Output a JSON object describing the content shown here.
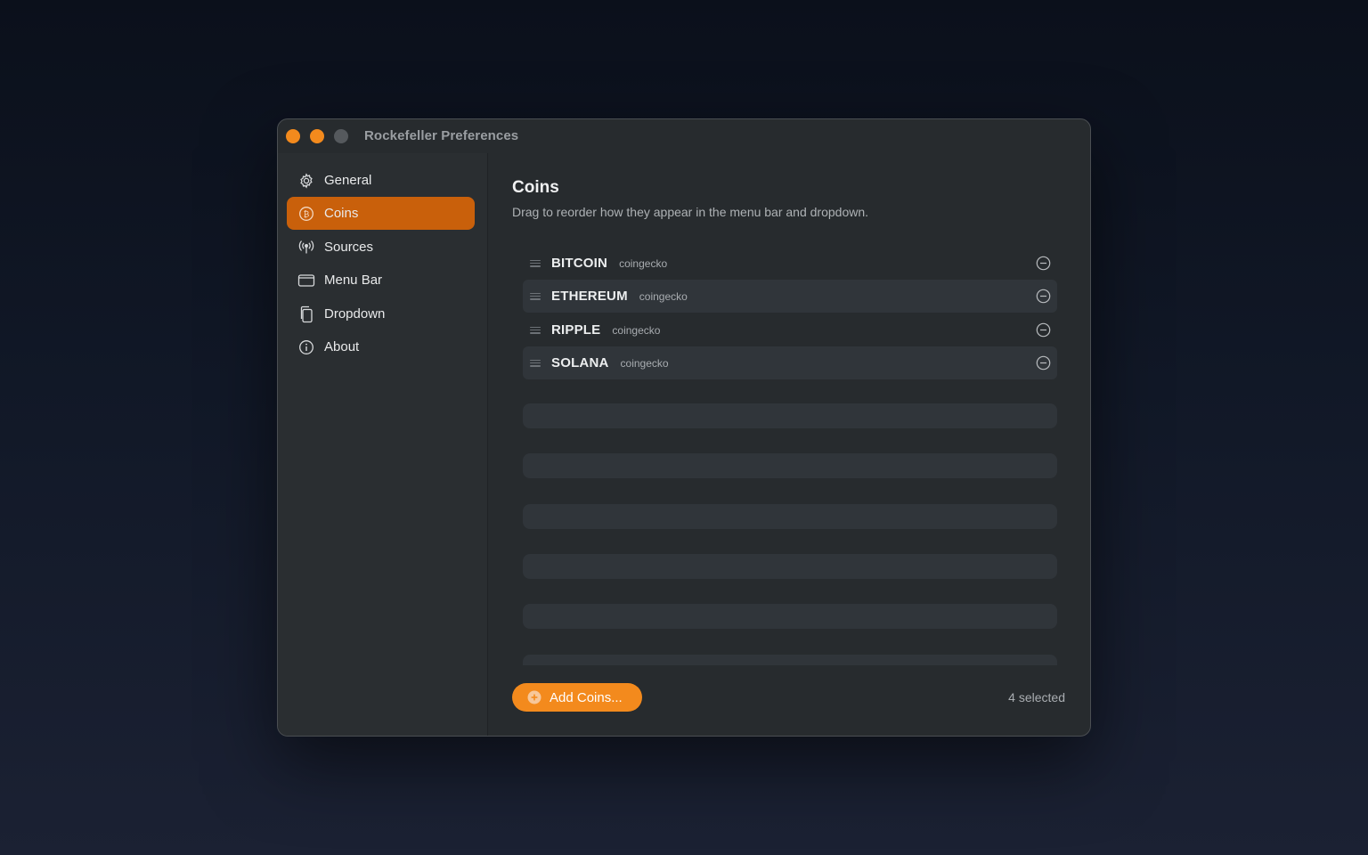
{
  "window": {
    "title": "Rockefeller Preferences"
  },
  "sidebar": {
    "items": [
      {
        "label": "General",
        "icon": "gear-icon",
        "active": false
      },
      {
        "label": "Coins",
        "icon": "bitcoin-icon",
        "active": true
      },
      {
        "label": "Sources",
        "icon": "antenna-icon",
        "active": false
      },
      {
        "label": "Menu Bar",
        "icon": "menubar-icon",
        "active": false
      },
      {
        "label": "Dropdown",
        "icon": "copy-icon",
        "active": false
      },
      {
        "label": "About",
        "icon": "info-icon",
        "active": false
      }
    ]
  },
  "main": {
    "title": "Coins",
    "subtitle": "Drag to reorder how they appear in the menu bar and dropdown.",
    "coins": [
      {
        "name": "BITCOIN",
        "source": "coingecko"
      },
      {
        "name": "ETHEREUM",
        "source": "coingecko"
      },
      {
        "name": "RIPPLE",
        "source": "coingecko"
      },
      {
        "name": "SOLANA",
        "source": "coingecko"
      }
    ],
    "add_button_label": "Add Coins...",
    "selected_count": "4 selected"
  },
  "colors": {
    "accent": "#f38a1d",
    "sidebar_active": "#c9600b",
    "window_bg": "#272b2e"
  }
}
